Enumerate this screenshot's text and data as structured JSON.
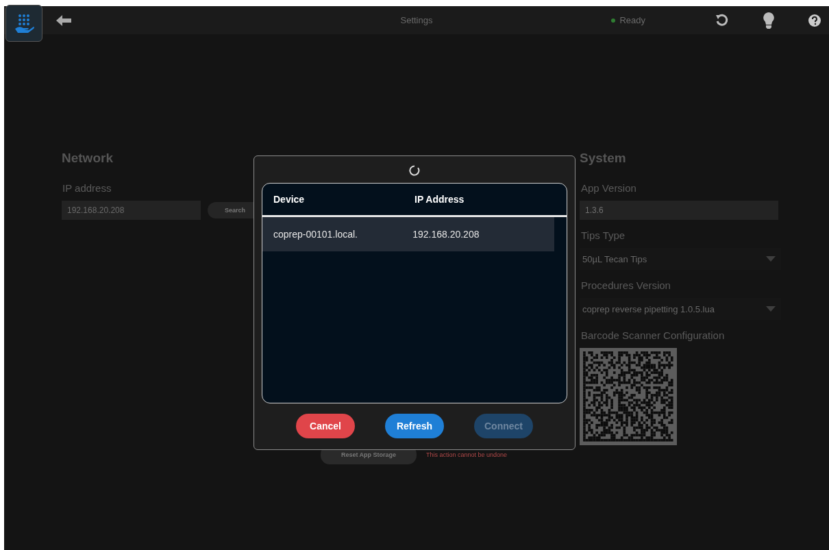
{
  "header": {
    "title": "Settings",
    "status": {
      "label": "Ready",
      "color": "#2f7d32"
    }
  },
  "network": {
    "heading": "Network",
    "ip_label": "IP address",
    "ip_placeholder": "192.168.20.208",
    "search_button": "Search"
  },
  "storage": {
    "reset_button": "Reset App Storage",
    "warning": "This action cannot be undone"
  },
  "system": {
    "heading": "System",
    "fields": [
      {
        "kind": "text",
        "label": "App Version",
        "value": "1.3.6"
      },
      {
        "kind": "select",
        "label": "Tips Type",
        "value": "50µL Tecan Tips"
      },
      {
        "kind": "select",
        "label": "Procedures Version",
        "value": "coprep reverse pipetting 1.0.5.lua"
      },
      {
        "kind": "barcode",
        "label": "Barcode Scanner Configuration"
      }
    ]
  },
  "dialog": {
    "columns": [
      "Device",
      "IP Address"
    ],
    "rows": [
      {
        "cells": [
          "coprep-00101.local.",
          "192.168.20.208"
        ],
        "selected": true
      }
    ],
    "buttons": [
      {
        "label": "Cancel",
        "kind": "danger",
        "disabled": false
      },
      {
        "label": "Refresh",
        "kind": "primary",
        "disabled": false
      },
      {
        "label": "Connect",
        "kind": "primary",
        "disabled": true
      }
    ]
  }
}
